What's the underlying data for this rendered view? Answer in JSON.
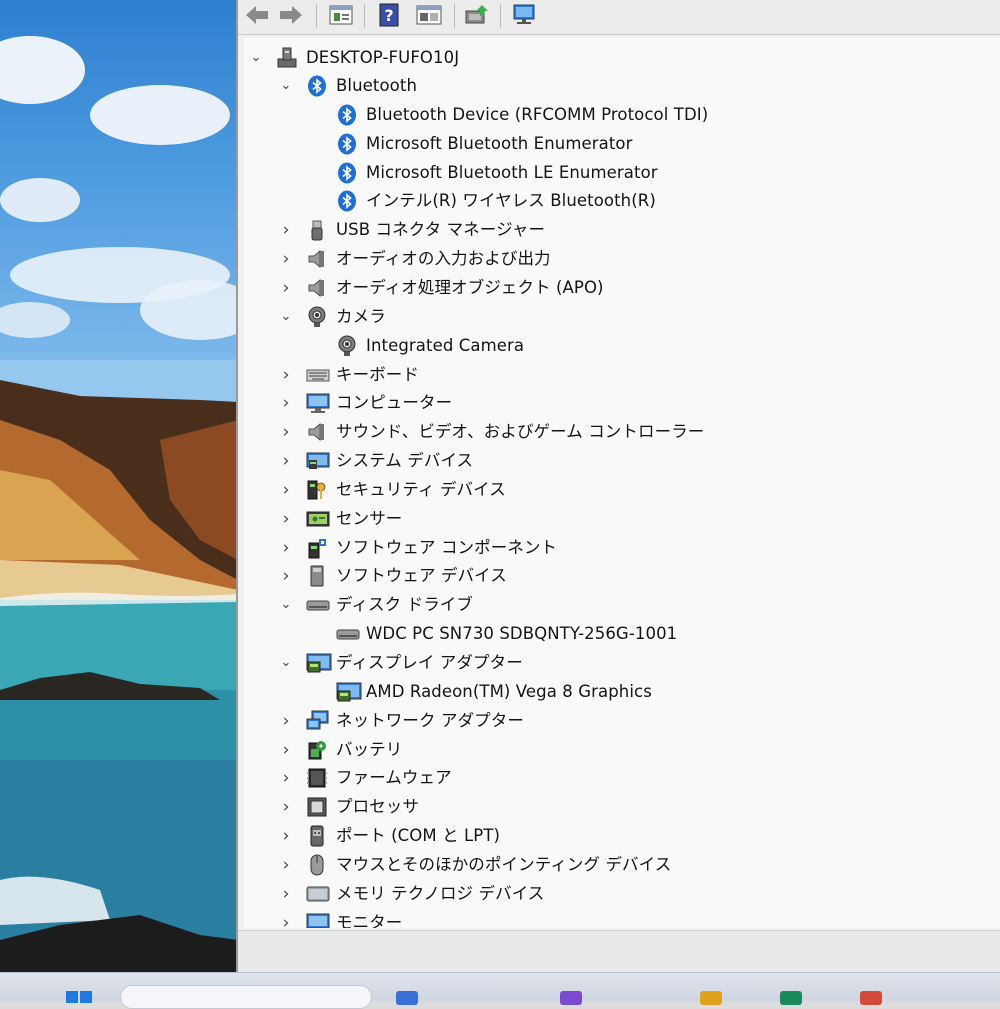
{
  "window": {
    "root": "DESKTOP-FUFO10J"
  },
  "toolbar": {
    "buttons": [
      "back-icon",
      "forward-icon",
      "properties-icon",
      "help-icon",
      "show-hidden-icon",
      "update-driver-icon",
      "monitor-scan-icon"
    ]
  },
  "tree": {
    "rows": [
      {
        "label": "Bluetooth",
        "level": 1,
        "state": "expanded",
        "icon": "bluetooth-icon"
      },
      {
        "label": "Bluetooth Device (RFCOMM Protocol TDI)",
        "level": 2,
        "state": "leaf",
        "icon": "bluetooth-icon"
      },
      {
        "label": "Microsoft Bluetooth Enumerator",
        "level": 2,
        "state": "leaf",
        "icon": "bluetooth-icon"
      },
      {
        "label": "Microsoft Bluetooth LE Enumerator",
        "level": 2,
        "state": "leaf",
        "icon": "bluetooth-icon"
      },
      {
        "label": "インテル(R) ワイヤレス Bluetooth(R)",
        "level": 2,
        "state": "leaf",
        "icon": "bluetooth-icon"
      },
      {
        "label": "USB コネクタ マネージャー",
        "level": 1,
        "state": "collapsed",
        "icon": "usb-icon"
      },
      {
        "label": "オーディオの入力および出力",
        "level": 1,
        "state": "collapsed",
        "icon": "speaker-icon"
      },
      {
        "label": "オーディオ処理オブジェクト (APO)",
        "level": 1,
        "state": "collapsed",
        "icon": "speaker-icon"
      },
      {
        "label": "カメラ",
        "level": 1,
        "state": "expanded",
        "icon": "camera-icon"
      },
      {
        "label": "Integrated Camera",
        "level": 2,
        "state": "leaf",
        "icon": "camera-icon"
      },
      {
        "label": "キーボード",
        "level": 1,
        "state": "collapsed",
        "icon": "keyboard-icon"
      },
      {
        "label": "コンピューター",
        "level": 1,
        "state": "collapsed",
        "icon": "computer-icon"
      },
      {
        "label": "サウンド、ビデオ、およびゲーム コントローラー",
        "level": 1,
        "state": "collapsed",
        "icon": "speaker-icon"
      },
      {
        "label": "システム デバイス",
        "level": 1,
        "state": "collapsed",
        "icon": "system-device-icon"
      },
      {
        "label": "セキュリティ デバイス",
        "level": 1,
        "state": "collapsed",
        "icon": "security-key-icon"
      },
      {
        "label": "センサー",
        "level": 1,
        "state": "collapsed",
        "icon": "sensor-icon"
      },
      {
        "label": "ソフトウェア コンポーネント",
        "level": 1,
        "state": "collapsed",
        "icon": "software-component-icon"
      },
      {
        "label": "ソフトウェア デバイス",
        "level": 1,
        "state": "collapsed",
        "icon": "software-device-icon"
      },
      {
        "label": "ディスク ドライブ",
        "level": 1,
        "state": "expanded",
        "icon": "disk-drive-icon"
      },
      {
        "label": "WDC PC SN730 SDBQNTY-256G-1001",
        "level": 2,
        "state": "leaf",
        "icon": "disk-drive-icon"
      },
      {
        "label": "ディスプレイ アダプター",
        "level": 1,
        "state": "expanded",
        "icon": "display-adapter-icon"
      },
      {
        "label": "AMD Radeon(TM) Vega 8 Graphics",
        "level": 2,
        "state": "leaf",
        "icon": "display-adapter-icon"
      },
      {
        "label": "ネットワーク アダプター",
        "level": 1,
        "state": "collapsed",
        "icon": "network-adapter-icon"
      },
      {
        "label": "バッテリ",
        "level": 1,
        "state": "collapsed",
        "icon": "battery-icon"
      },
      {
        "label": "ファームウェア",
        "level": 1,
        "state": "collapsed",
        "icon": "firmware-icon"
      },
      {
        "label": "プロセッサ",
        "level": 1,
        "state": "collapsed",
        "icon": "processor-icon"
      },
      {
        "label": "ポート (COM と LPT)",
        "level": 1,
        "state": "collapsed",
        "icon": "port-icon"
      },
      {
        "label": "マウスとそのほかのポインティング デバイス",
        "level": 1,
        "state": "collapsed",
        "icon": "mouse-icon"
      },
      {
        "label": "メモリ テクノロジ デバイス",
        "level": 1,
        "state": "collapsed",
        "icon": "memory-device-icon"
      },
      {
        "label": "モニター",
        "level": 1,
        "state": "collapsed",
        "icon": "monitor-icon"
      }
    ]
  },
  "colors": {
    "bluetooth": "#1e6fd9",
    "tree_bg": "#f9f9f9",
    "text": "#141414"
  }
}
